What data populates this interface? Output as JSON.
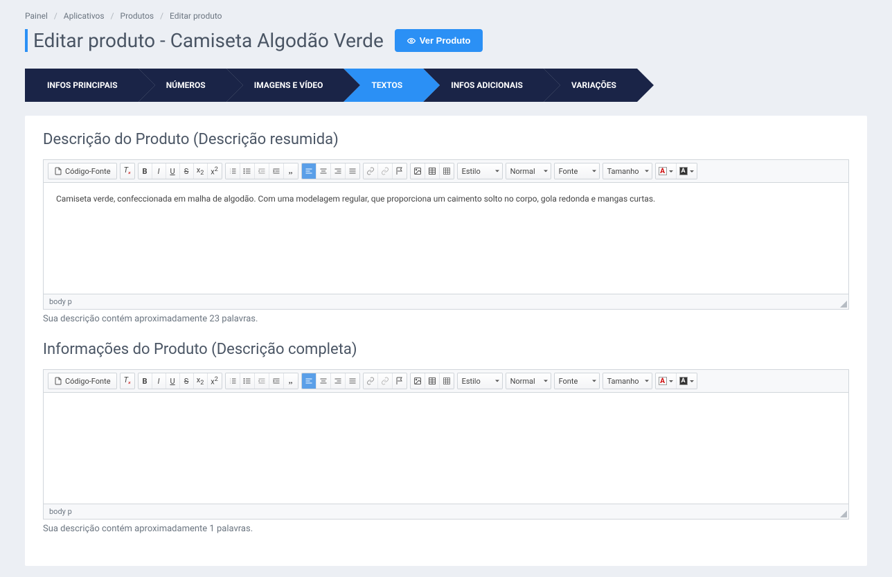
{
  "breadcrumb": {
    "items": [
      "Painel",
      "Aplicativos",
      "Produtos",
      "Editar produto"
    ]
  },
  "page": {
    "title": "Editar produto - Camiseta Algodão Verde",
    "view_button": "Ver Produto"
  },
  "tabs": [
    {
      "label": "INFOS PRINCIPAIS",
      "active": false
    },
    {
      "label": "NÚMEROS",
      "active": false
    },
    {
      "label": "IMAGENS E VÍDEO",
      "active": false
    },
    {
      "label": "TEXTOS",
      "active": true
    },
    {
      "label": "INFOS ADICIONAIS",
      "active": false
    },
    {
      "label": "VARIAÇÕES",
      "active": false
    }
  ],
  "sections": {
    "short": {
      "title": "Descrição do Produto (Descrição resumida)",
      "content": "Camiseta verde, confeccionada em malha de algodão. Com uma modelagem regular, que proporciona um caimento solto no corpo, gola redonda e mangas curtas.",
      "path": "body   p",
      "help": "Sua descrição contém aproximadamente 23 palavras."
    },
    "full": {
      "title": "Informações do Produto (Descrição completa)",
      "content": "",
      "path": "body   p",
      "help": "Sua descrição contém aproximadamente 1 palavras."
    }
  },
  "toolbar": {
    "source": "Código-Fonte",
    "style": "Estilo",
    "format": "Normal",
    "font": "Fonte",
    "size": "Tamanho"
  }
}
